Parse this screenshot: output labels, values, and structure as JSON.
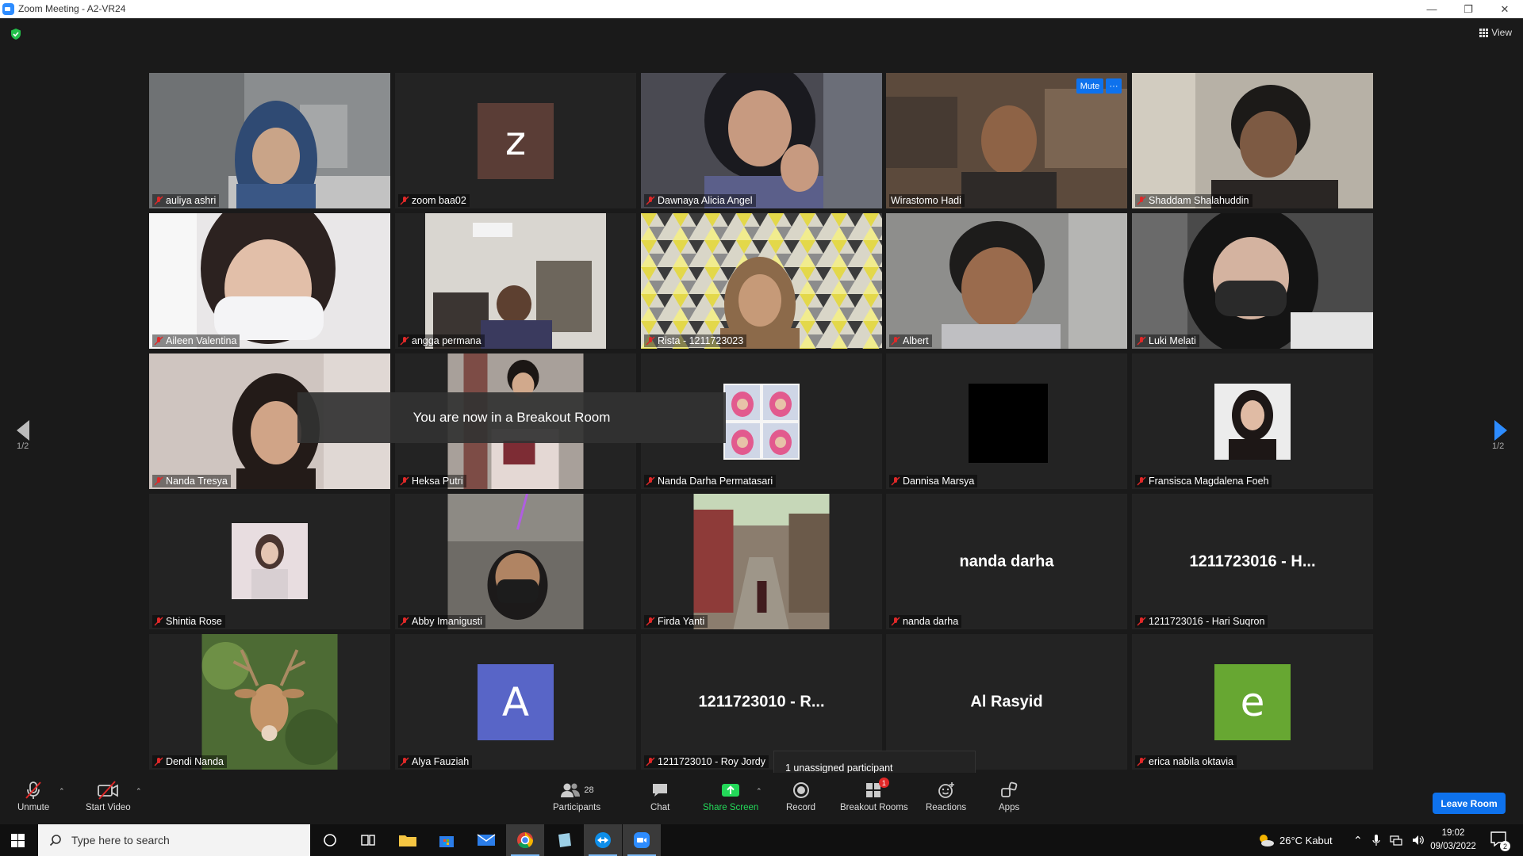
{
  "window": {
    "title": "Zoom Meeting - A2-VR24"
  },
  "meeting": {
    "view_label": "View",
    "page_left": "1/2",
    "page_right": "1/2",
    "breakout_message": "You are now in a Breakout Room",
    "unassigned_tooltip": "1 unassigned participant"
  },
  "tiles": [
    {
      "name": "auliya ashri",
      "kind": "video"
    },
    {
      "name": "zoom baa02",
      "kind": "letter",
      "letter": "z",
      "color": "#5a3d36"
    },
    {
      "name": "Dawnaya Alicia Angel",
      "kind": "video"
    },
    {
      "name": "Wirastomo Hadi",
      "kind": "video",
      "active": true,
      "mute_label": "Mute",
      "more_label": "···"
    },
    {
      "name": "Shaddam Shalahuddin",
      "kind": "video"
    },
    {
      "name": "Aileen Valentina",
      "kind": "video"
    },
    {
      "name": "angga permana",
      "kind": "video"
    },
    {
      "name": "Rista - 1211723023",
      "kind": "video"
    },
    {
      "name": "Albert",
      "kind": "video"
    },
    {
      "name": "Luki Melati",
      "kind": "video"
    },
    {
      "name": "Nanda Tresya",
      "kind": "video"
    },
    {
      "name": "Heksa Putri",
      "kind": "video"
    },
    {
      "name": "Nanda Darha Permatasari",
      "kind": "photo"
    },
    {
      "name": "Dannisa Marsya",
      "kind": "photo"
    },
    {
      "name": "Fransisca Magdalena Foeh",
      "kind": "photo"
    },
    {
      "name": "Shintia Rose",
      "kind": "photo"
    },
    {
      "name": "Abby Imanigusti",
      "kind": "video"
    },
    {
      "name": "Firda Yanti",
      "kind": "video"
    },
    {
      "name": "nanda darha",
      "kind": "text",
      "display": "nanda darha"
    },
    {
      "name": "1211723016 - Hari Suqron",
      "kind": "text",
      "display": "1211723016 - H..."
    },
    {
      "name": "Dendi Nanda",
      "kind": "photo"
    },
    {
      "name": "Alya Fauziah",
      "kind": "letter",
      "letter": "A",
      "color": "#5865c7"
    },
    {
      "name": "1211723010 - Roy Jordy",
      "kind": "text",
      "display": "1211723010 - R..."
    },
    {
      "name": "Al Rasyid",
      "kind": "text",
      "display": "Al Rasyid",
      "hide_nameplate": true
    },
    {
      "name": "erica nabila oktavia",
      "kind": "letter",
      "letter": "e",
      "color": "#67a732"
    }
  ],
  "toolbar": {
    "unmute": "Unmute",
    "start_video": "Start Video",
    "participants": "Participants",
    "participants_count": "28",
    "chat": "Chat",
    "share_screen": "Share Screen",
    "record": "Record",
    "breakout_rooms": "Breakout Rooms",
    "breakout_badge": "1",
    "reactions": "Reactions",
    "apps": "Apps",
    "leave": "Leave Room"
  },
  "taskbar": {
    "search_placeholder": "Type here to search",
    "weather": "26°C  Kabut",
    "time": "19:02",
    "date": "09/03/2022",
    "notification_count": "2"
  },
  "colors": {
    "accent": "#0e72ed",
    "share_green": "#23d959",
    "active_border": "#f1e87a",
    "mic_off_red": "#e02828"
  }
}
